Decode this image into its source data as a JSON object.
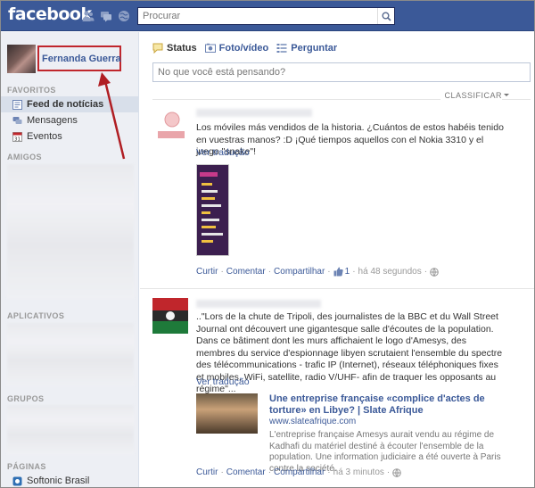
{
  "topbar": {
    "logo": "facebook",
    "search_placeholder": "Procurar",
    "icons": [
      "friend-requests-icon",
      "messages-icon",
      "notifications-icon"
    ]
  },
  "sidebar": {
    "profile_name": "Fernanda Guerra",
    "sections": {
      "favorites": "FAVORITOS",
      "friends": "AMIGOS",
      "apps": "APLICATIVOS",
      "groups": "GRUPOS",
      "pages": "PÁGINAS"
    },
    "favorites": [
      {
        "label": "Feed de notícias",
        "icon": "news-feed-icon",
        "active": true
      },
      {
        "label": "Mensagens",
        "icon": "messages-icon",
        "active": false
      },
      {
        "label": "Eventos",
        "icon": "calendar-icon",
        "active": false
      }
    ],
    "pages": [
      {
        "label": "Softonic Brasil",
        "icon": "softonic-icon"
      }
    ]
  },
  "composer": {
    "tabs": [
      {
        "label": "Status",
        "icon": "status-icon"
      },
      {
        "label": "Foto/vídeo",
        "icon": "photo-icon"
      },
      {
        "label": "Perguntar",
        "icon": "question-icon"
      }
    ],
    "placeholder": "No que você está pensando?",
    "sort_label": "CLASSIFICAR"
  },
  "posts": [
    {
      "text": "Los móviles más vendidos de la historia. ¿Cuántos de estos habéis tenido en vuestras manos? :D ¡Qué tiempos aquellos con el Nokia 3310 y el juego \"snake\"!",
      "see_translation": "Ver tradução",
      "actions": {
        "like": "Curtir",
        "comment": "Comentar",
        "share": "Compartilhar",
        "like_count": "1",
        "time": "há 48 segundos"
      }
    },
    {
      "text": "..\"Lors de la chute de Tripoli, des journalistes de la BBC et du Wall Street Journal ont découvert une gigantesque salle d'écoutes de la population. Dans ce bâtiment dont les murs affichaient le logo d'Amesys, des membres du service d'espionnage libyen scrutaient l'ensemble du spectre des télécommunications - trafic IP (Internet), réseaux téléphoniques fixes et mobiles, WiFi, satellite, radio V/UHF- afin de traquer les opposants au régime\"...",
      "see_translation": "Ver tradução",
      "link": {
        "title": "Une entreprise française «complice d'actes de torture» en Libye? | Slate Afrique",
        "domain": "www.slateafrique.com",
        "description": "L'entreprise française Amesys aurait vendu au régime de Kadhafi du matériel destiné à écouter l'ensemble de la population. Une information judiciaire a été ouverte à Paris contre la société."
      },
      "actions": {
        "like": "Curtir",
        "comment": "Comentar",
        "share": "Compartilhar",
        "time": "há 3 minutos"
      }
    }
  ],
  "colors": {
    "brand": "#3b5998",
    "highlight": "#c0262c"
  }
}
